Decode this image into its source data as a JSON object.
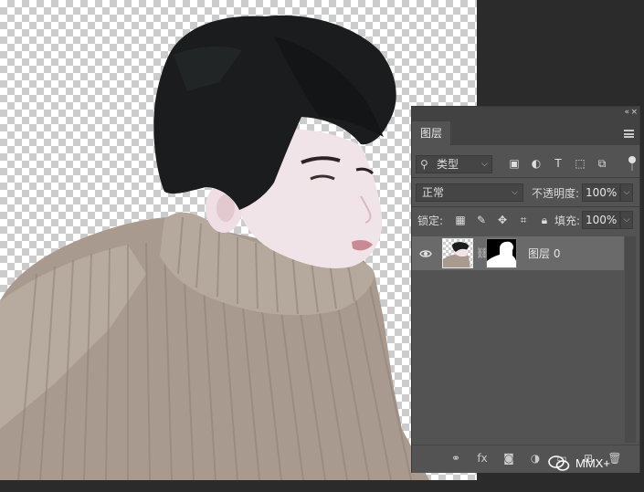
{
  "canvas": {
    "subject": "person-cutout"
  },
  "layers_panel": {
    "collapse_glyph": "«",
    "close_glyph": "×",
    "tab_label": "图层",
    "filter": {
      "icon": "search-icon",
      "label": "类型",
      "chevron": "⌵"
    },
    "filter_icons": [
      {
        "name": "filter-pixel-icon",
        "glyph": "▣"
      },
      {
        "name": "filter-adjustment-icon",
        "glyph": "◐"
      },
      {
        "name": "filter-type-icon",
        "glyph": "T"
      },
      {
        "name": "filter-shape-icon",
        "glyph": "⬚"
      },
      {
        "name": "filter-smart-object-icon",
        "glyph": "⧉"
      }
    ],
    "blend_mode": "正常",
    "opacity_label": "不透明度:",
    "opacity_value": "100%",
    "lock_label": "锁定:",
    "lock_icons": [
      {
        "name": "lock-transparent-pixels-icon",
        "glyph": "▦"
      },
      {
        "name": "lock-image-pixels-icon",
        "glyph": "✎"
      },
      {
        "name": "lock-position-icon",
        "glyph": "✥"
      },
      {
        "name": "lock-artboard-icon",
        "glyph": "⌗"
      },
      {
        "name": "lock-all-icon",
        "glyph": "🔒︎"
      }
    ],
    "fill_label": "填充:",
    "fill_value": "100%",
    "layers": [
      {
        "name": "图层 0",
        "visible": true,
        "has_mask": true
      }
    ],
    "footer_icons": [
      {
        "name": "link-layers-icon",
        "glyph": "⚭"
      },
      {
        "name": "layer-style-icon",
        "glyph": "fx"
      },
      {
        "name": "add-mask-icon",
        "glyph": "◙"
      },
      {
        "name": "adjustment-layer-icon",
        "glyph": "◑"
      },
      {
        "name": "new-group-icon",
        "glyph": "▭"
      },
      {
        "name": "new-layer-icon",
        "glyph": "⊞"
      },
      {
        "name": "delete-layer-icon",
        "glyph": "🗑︎"
      }
    ]
  },
  "watermark": {
    "text": "MMX+"
  },
  "colors": {
    "panel_bg": "#535353",
    "panel_header": "#424242",
    "app_bg": "#2b2b2b",
    "selected_layer": "#6a6a6a"
  }
}
